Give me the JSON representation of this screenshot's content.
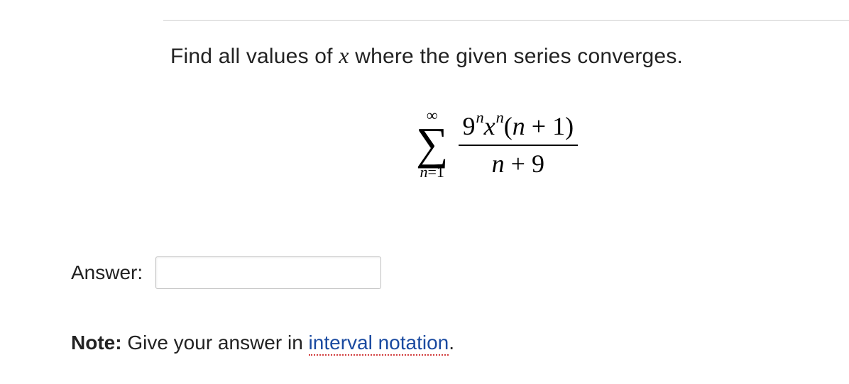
{
  "question": {
    "prefix": "Find all values of ",
    "variable": "x",
    "suffix": " where the given series converges."
  },
  "formula": {
    "sigma_top": "∞",
    "sigma_bottom_var": "n",
    "sigma_bottom_eq": "=",
    "sigma_bottom_val": "1",
    "numerator": {
      "base1": "9",
      "exp1": "n",
      "base2": "x",
      "exp2": "n",
      "paren_open": "(",
      "var3": "n",
      "plus": " + ",
      "const": "1",
      "paren_close": ")"
    },
    "denominator": {
      "var": "n",
      "plus": " + ",
      "const": "9"
    }
  },
  "answer": {
    "label": "Answer:",
    "value": ""
  },
  "note": {
    "bold": "Note:",
    "text": " Give your answer in ",
    "link": "interval notation",
    "period": "."
  }
}
